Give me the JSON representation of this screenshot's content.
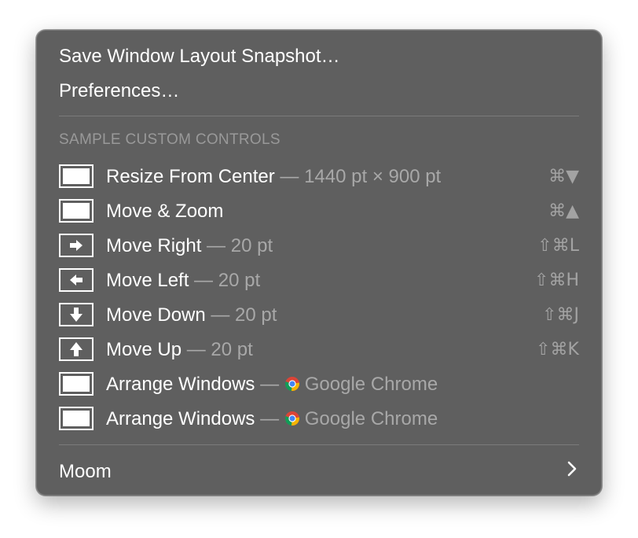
{
  "menu": {
    "top_items": [
      {
        "label": "Save Window Layout Snapshot…"
      },
      {
        "label": "Preferences…"
      }
    ],
    "section_header": "SAMPLE CUSTOM CONTROLS",
    "controls": [
      {
        "title": "Resize From Center",
        "detail": " — 1440 pt × 900 pt",
        "shortcut": "⌘▼",
        "icon": "window-full-icon"
      },
      {
        "title": "Move & Zoom",
        "detail": "",
        "shortcut": "⌘▲",
        "icon": "window-full-icon"
      },
      {
        "title": "Move Right",
        "detail": " — 20 pt",
        "shortcut": "⇧⌘L",
        "icon": "arrow-right-icon"
      },
      {
        "title": "Move Left",
        "detail": " — 20 pt",
        "shortcut": "⇧⌘H",
        "icon": "arrow-left-icon"
      },
      {
        "title": "Move Down",
        "detail": " — 20 pt",
        "shortcut": "⇧⌘J",
        "icon": "arrow-down-icon"
      },
      {
        "title": "Move Up",
        "detail": " — 20 pt",
        "shortcut": "⇧⌘K",
        "icon": "arrow-up-icon"
      },
      {
        "title": "Arrange Windows",
        "detail": " — ",
        "app": "Google Chrome",
        "shortcut": "",
        "icon": "window-full-icon",
        "app_icon": "chrome-icon"
      },
      {
        "title": "Arrange Windows",
        "detail": " — ",
        "app": "Google Chrome",
        "shortcut": "",
        "icon": "window-full-icon",
        "app_icon": "chrome-icon"
      }
    ],
    "submenu": {
      "label": "Moom",
      "icon": "chevron-right-icon"
    },
    "colors": {
      "background": "#5f5f5f",
      "text": "#ffffff",
      "muted": "#a8a8a8",
      "header": "#999999"
    }
  }
}
